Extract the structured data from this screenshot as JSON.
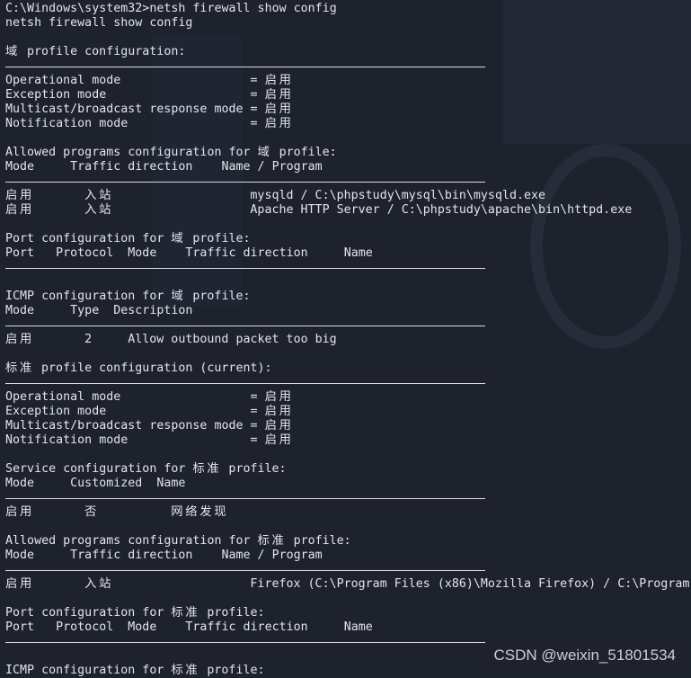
{
  "terminal": {
    "lines": [
      {
        "t": "C:\\Windows\\system32>netsh firewall show config"
      },
      {
        "t": "netsh firewall show config"
      },
      {
        "t": ""
      },
      {
        "t": "域 profile configuration:"
      },
      {
        "sep": true
      },
      {
        "t": "Operational mode                  = 启用"
      },
      {
        "t": "Exception mode                    = 启用"
      },
      {
        "t": "Multicast/broadcast response mode = 启用"
      },
      {
        "t": "Notification mode                 = 启用"
      },
      {
        "t": ""
      },
      {
        "t": "Allowed programs configuration for 域 profile:"
      },
      {
        "t": "Mode     Traffic direction    Name / Program"
      },
      {
        "sep": true
      },
      {
        "t": "启用       入站                   mysqld / C:\\phpstudy\\mysql\\bin\\mysqld.exe"
      },
      {
        "t": "启用       入站                   Apache HTTP Server / C:\\phpstudy\\apache\\bin\\httpd.exe"
      },
      {
        "t": ""
      },
      {
        "t": "Port configuration for 域 profile:"
      },
      {
        "t": "Port   Protocol  Mode    Traffic direction     Name"
      },
      {
        "sep": true
      },
      {
        "t": ""
      },
      {
        "t": "ICMP configuration for 域 profile:"
      },
      {
        "t": "Mode     Type  Description"
      },
      {
        "sep": true
      },
      {
        "t": "启用       2     Allow outbound packet too big"
      },
      {
        "t": ""
      },
      {
        "t": "标准 profile configuration (current):"
      },
      {
        "sep": true
      },
      {
        "t": "Operational mode                  = 启用"
      },
      {
        "t": "Exception mode                    = 启用"
      },
      {
        "t": "Multicast/broadcast response mode = 启用"
      },
      {
        "t": "Notification mode                 = 启用"
      },
      {
        "t": ""
      },
      {
        "t": "Service configuration for 标准 profile:"
      },
      {
        "t": "Mode     Customized  Name"
      },
      {
        "sep": true
      },
      {
        "t": "启用       否          网络发现"
      },
      {
        "t": ""
      },
      {
        "t": "Allowed programs configuration for 标准 profile:"
      },
      {
        "t": "Mode     Traffic direction    Name / Program"
      },
      {
        "sep": true
      },
      {
        "t": "启用       入站                   Firefox (C:\\Program Files (x86)\\Mozilla Firefox) / C:\\Program"
      },
      {
        "t": ""
      },
      {
        "t": "Port configuration for 标准 profile:"
      },
      {
        "t": "Port   Protocol  Mode    Traffic direction     Name"
      },
      {
        "sep": true
      },
      {
        "t": ""
      },
      {
        "t": "ICMP configuration for 标准 profile:"
      }
    ]
  },
  "watermark": "CSDN @weixin_51801534",
  "colors": {
    "background": "#1d222d",
    "text": "#e2e5ea"
  }
}
